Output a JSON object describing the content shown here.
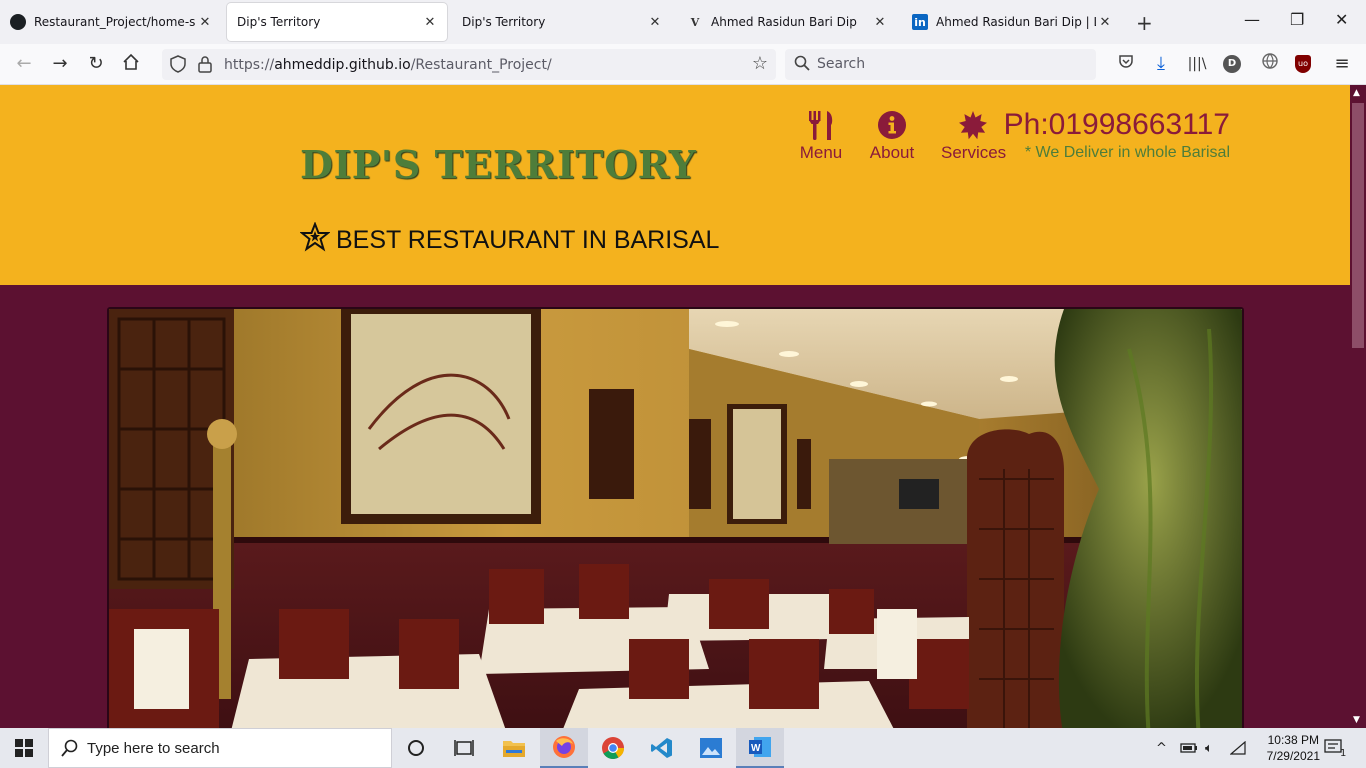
{
  "browser": {
    "tabs": [
      {
        "title": "Restaurant_Project/home-snipp",
        "favicon": "github-icon",
        "active": false
      },
      {
        "title": "Dip's Territory",
        "favicon": "none",
        "active": true
      },
      {
        "title": "Dip's Territory",
        "favicon": "none",
        "active": false
      },
      {
        "title": "Ahmed Rasidun Bari Dip",
        "favicon": "vercel-v-icon",
        "active": false
      },
      {
        "title": "Ahmed Rasidun Bari Dip | Linke",
        "favicon": "linkedin-icon",
        "active": false
      }
    ],
    "url_prefix": "https://",
    "url_host": "ahmeddip.github.io",
    "url_path": "/Restaurant_Project/",
    "search_placeholder": "Search",
    "profile_letter": "D",
    "ublock_label": "uo"
  },
  "site": {
    "brand": "DIP'S TERRITORY",
    "tagline": "BEST RESTAURANT IN BARISAL",
    "nav": [
      {
        "label": "Menu",
        "icon": "utensils-icon"
      },
      {
        "label": "About",
        "icon": "info-circle-icon"
      },
      {
        "label": "Services",
        "icon": "star-burst-icon"
      }
    ],
    "phone": "Ph:01998663117",
    "delivery": "* We Deliver in whole Barisal",
    "colors": {
      "header": "#f4b21e",
      "body": "#5c1131",
      "accent": "#8a1b3a",
      "brand": "#4e7d3a"
    }
  },
  "taskbar": {
    "search_placeholder": "Type here to search",
    "apps": [
      "cortana-icon",
      "task-view-icon",
      "file-explorer-icon",
      "firefox-icon",
      "chrome-icon",
      "vscode-icon",
      "photos-icon",
      "word-icon"
    ],
    "time": "10:38 PM",
    "date": "7/29/2021",
    "notification_count": "1"
  }
}
